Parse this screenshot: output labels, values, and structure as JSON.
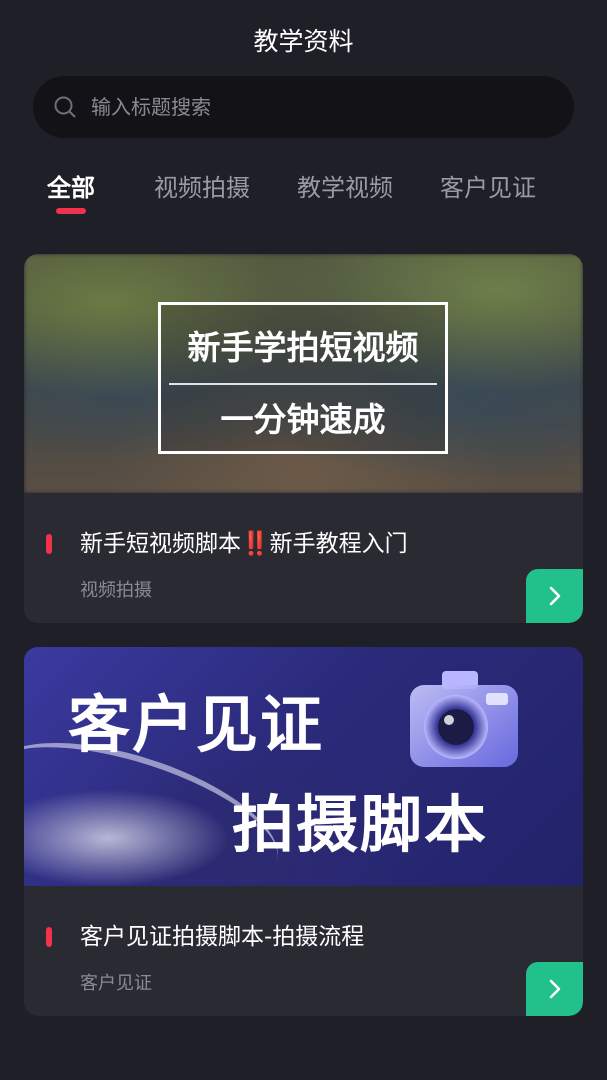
{
  "header": {
    "title": "教学资料"
  },
  "search": {
    "placeholder": "输入标题搜索",
    "value": ""
  },
  "tabs": [
    {
      "label": "全部",
      "active": true
    },
    {
      "label": "视频拍摄",
      "active": false
    },
    {
      "label": "教学视频",
      "active": false
    },
    {
      "label": "客户见证",
      "active": false
    }
  ],
  "cards": [
    {
      "cover_line1": "新手学拍短视频",
      "cover_line2": "一分钟速成",
      "title": "新手短视频脚本‼️新手教程入门",
      "category": "视频拍摄",
      "arrow_icon": "chevron-right-icon"
    },
    {
      "cover_line1": "客户见证",
      "cover_line2": "拍摄脚本",
      "title": "客户见证拍摄脚本-拍摄流程",
      "category": "客户见证",
      "arrow_icon": "chevron-right-icon"
    }
  ],
  "colors": {
    "background": "#1f1f27",
    "card": "#2a2a33",
    "accent_red": "#f0324d",
    "accent_green": "#22c08a"
  }
}
